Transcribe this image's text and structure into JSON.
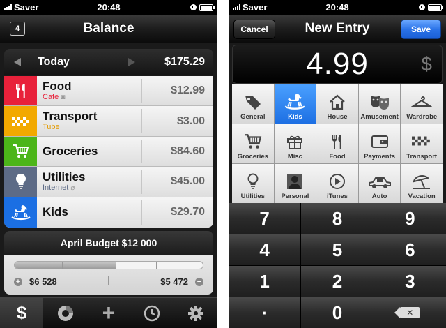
{
  "status": {
    "carrier": "Saver",
    "time": "20:48"
  },
  "left": {
    "title": "Balance",
    "calendar_badge": "4",
    "day_label": "Today",
    "day_total": "$175.29",
    "categories": [
      {
        "name": "Food",
        "sub": "Cafe",
        "amount": "$12.99",
        "color": "#e8213a",
        "sub_color": "#e8213a",
        "icon": "fork-knife-icon"
      },
      {
        "name": "Transport",
        "sub": "Tube",
        "amount": "$3.00",
        "color": "#f2a900",
        "sub_color": "#e39b00",
        "icon": "taxi-sign-icon"
      },
      {
        "name": "Groceries",
        "sub": "",
        "amount": "$84.60",
        "color": "#4cb519",
        "sub_color": "#333",
        "icon": "cart-icon"
      },
      {
        "name": "Utilities",
        "sub": "Internet",
        "amount": "$45.00",
        "color": "#5d6b86",
        "sub_color": "#5d6b86",
        "icon": "lightbulb-icon"
      },
      {
        "name": "Kids",
        "sub": "",
        "amount": "$29.70",
        "color": "#1b6fe3",
        "sub_color": "#333",
        "icon": "rocking-horse-icon"
      }
    ],
    "budget": {
      "title": "April Budget $12 000",
      "spent": "$6 528",
      "remaining": "$5 472",
      "spent_fraction": 0.54
    },
    "tabs": [
      {
        "icon": "dollar-icon",
        "glyph": "$"
      },
      {
        "icon": "donut-chart-icon",
        "glyph": ""
      },
      {
        "icon": "plus-icon",
        "glyph": "+"
      },
      {
        "icon": "clock-icon",
        "glyph": ""
      },
      {
        "icon": "gear-icon",
        "glyph": ""
      }
    ]
  },
  "right": {
    "title": "New Entry",
    "cancel": "Cancel",
    "save": "Save",
    "amount": "4.99",
    "currency": "$",
    "categories": [
      "General",
      "Kids",
      "House",
      "Amusement",
      "Wardrobe",
      "Groceries",
      "Misc",
      "Food",
      "Payments",
      "Transport",
      "Utilities",
      "Personal",
      "iTunes",
      "Auto",
      "Vacation"
    ],
    "selected_category": "Kids",
    "keys": [
      "7",
      "8",
      "9",
      "4",
      "5",
      "6",
      "1",
      "2",
      "3",
      "·",
      "0",
      ""
    ]
  },
  "colors": {
    "accent_blue": "#1d6fe3"
  }
}
